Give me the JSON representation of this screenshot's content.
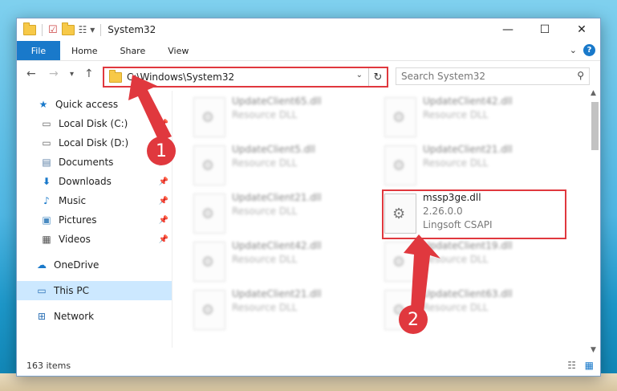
{
  "window": {
    "title": "System32"
  },
  "ribbon": {
    "tabs": [
      "File",
      "Home",
      "Share",
      "View"
    ]
  },
  "address": {
    "path": "C:\\Windows\\System32"
  },
  "search": {
    "placeholder": "Search System32"
  },
  "sidebar": {
    "items": [
      {
        "label": "Quick access",
        "icon": "star-icon",
        "pinned": false
      },
      {
        "label": "Local Disk (C:)",
        "icon": "drive-icon",
        "pinned": true
      },
      {
        "label": "Local Disk (D:)",
        "icon": "drive-icon",
        "pinned": false
      },
      {
        "label": "Documents",
        "icon": "documents-icon",
        "pinned": true
      },
      {
        "label": "Downloads",
        "icon": "download-icon",
        "pinned": true
      },
      {
        "label": "Music",
        "icon": "music-icon",
        "pinned": true
      },
      {
        "label": "Pictures",
        "icon": "pictures-icon",
        "pinned": true
      },
      {
        "label": "Videos",
        "icon": "videos-icon",
        "pinned": true
      },
      {
        "label": "OneDrive",
        "icon": "cloud-icon",
        "pinned": false
      },
      {
        "label": "This PC",
        "icon": "pc-icon",
        "pinned": false
      },
      {
        "label": "Network",
        "icon": "network-icon",
        "pinned": false
      }
    ]
  },
  "files": [
    {
      "name": "UpdateClient65.dll",
      "type": "Resource DLL"
    },
    {
      "name": "UpdateClient42.dll",
      "type": "Resource DLL"
    },
    {
      "name": "UpdateClient5.dll",
      "type": "Resource DLL"
    },
    {
      "name": "UpdateClient21.dll",
      "type": "Resource DLL"
    },
    {
      "name": "UpdateClient21.dll",
      "type": "Resource DLL"
    },
    {
      "name": "mssp3ge.dll",
      "version": "2.26.0.0",
      "type": "Lingsoft CSAPI"
    },
    {
      "name": "UpdateClient42.dll",
      "type": "Resource DLL"
    },
    {
      "name": "UpdateClient19.dll",
      "type": "Resource DLL"
    },
    {
      "name": "UpdateClient21.dll",
      "type": "Resource DLL"
    },
    {
      "name": "UpdateClient63.dll",
      "type": "Resource DLL"
    }
  ],
  "status": {
    "items": "163 items"
  },
  "annotations": [
    "1",
    "2"
  ],
  "colors": {
    "accent": "#1979ca",
    "highlight": "#e0383e"
  }
}
